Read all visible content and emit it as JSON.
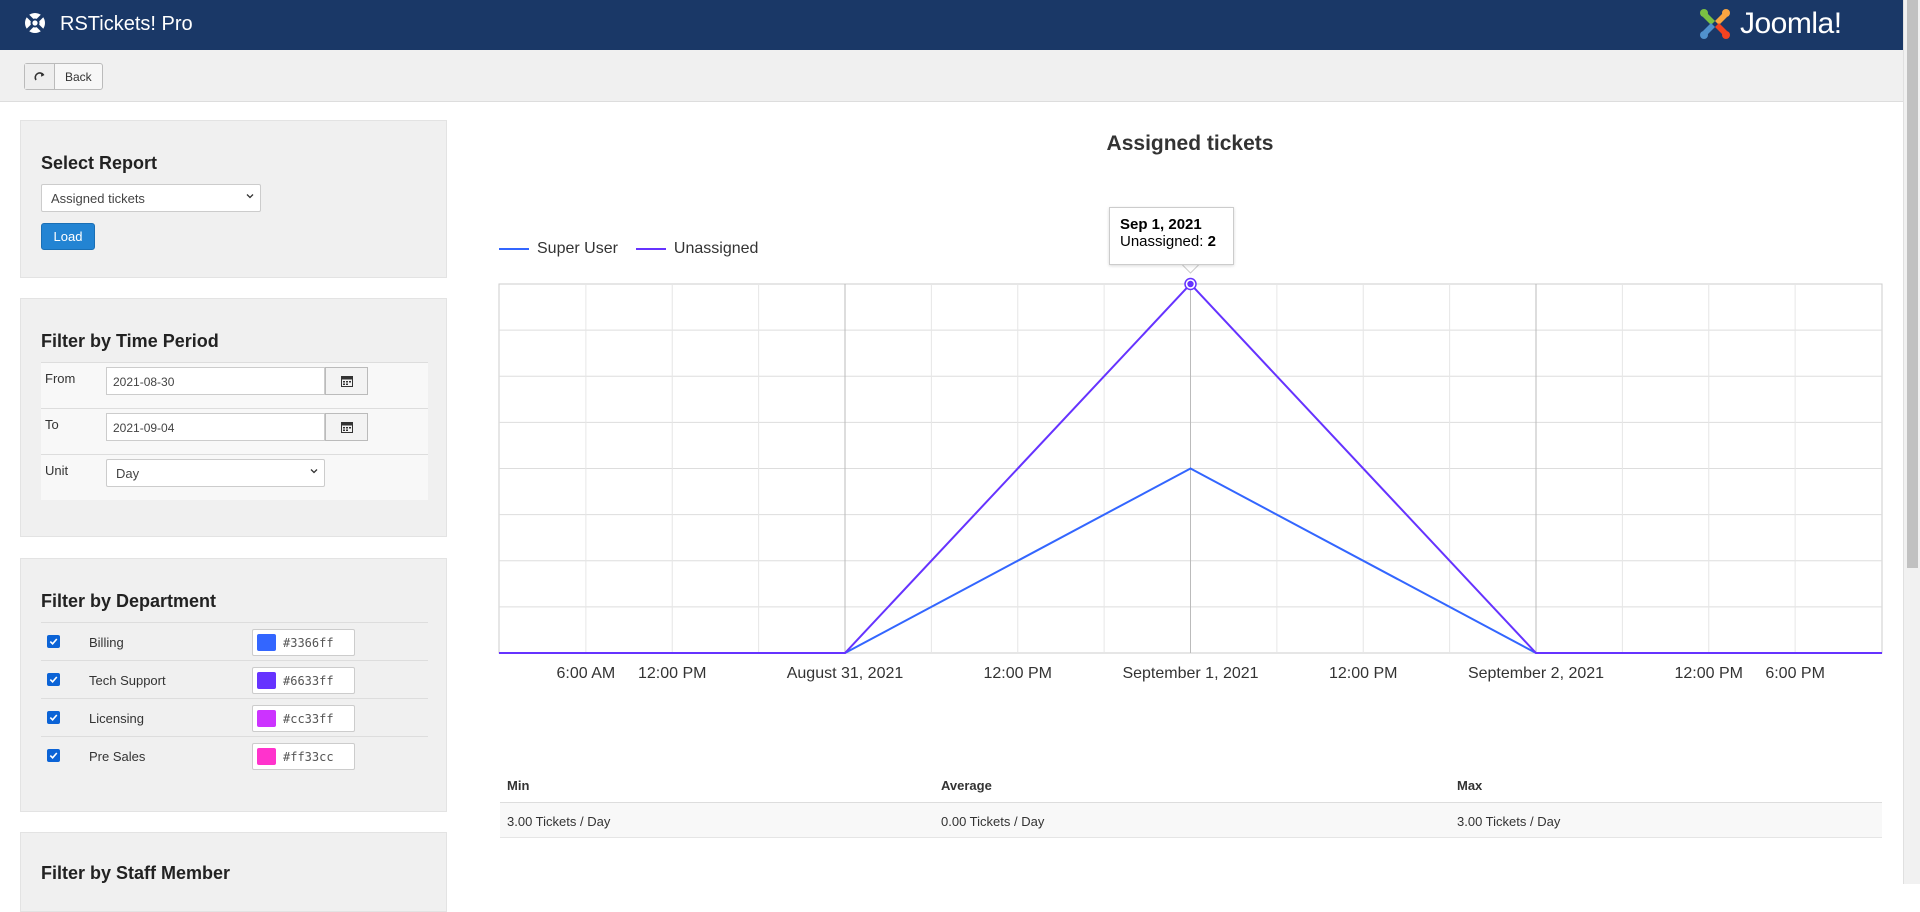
{
  "header": {
    "title": "RSTickets! Pro",
    "brand": "Joomla!",
    "color": "#1a3867"
  },
  "toolbar": {
    "back_label": "Back"
  },
  "select_report": {
    "heading": "Select Report",
    "selected": "Assigned tickets",
    "load_label": "Load"
  },
  "time_filter": {
    "heading": "Filter by Time Period",
    "from_label": "From",
    "from_value": "2021-08-30",
    "to_label": "To",
    "to_value": "2021-09-04",
    "unit_label": "Unit",
    "unit_value": "Day"
  },
  "department_filter": {
    "heading": "Filter by Department",
    "items": [
      {
        "name": "Billing",
        "color": "#3366ff",
        "checked": true
      },
      {
        "name": "Tech Support",
        "color": "#6633ff",
        "checked": true
      },
      {
        "name": "Licensing",
        "color": "#cc33ff",
        "checked": true
      },
      {
        "name": "Pre Sales",
        "color": "#ff33cc",
        "checked": true
      }
    ]
  },
  "staff_filter": {
    "heading": "Filter by Staff Member"
  },
  "tooltip": {
    "date": "Sep 1, 2021",
    "series": "Unassigned:",
    "value": "2"
  },
  "chart_data": {
    "type": "line",
    "title": "Assigned tickets",
    "x_tick_labels": [
      "6:00 AM",
      "12:00 PM",
      "August 31, 2021",
      "12:00 PM",
      "September 1, 2021",
      "12:00 PM",
      "September 2, 2021",
      "12:00 PM",
      "6:00 PM"
    ],
    "x": [
      "2021-08-31",
      "2021-09-01",
      "2021-09-02"
    ],
    "series": [
      {
        "name": "Super User",
        "color": "#3366ff",
        "values": [
          0,
          1,
          0
        ]
      },
      {
        "name": "Unassigned",
        "color": "#6633ff",
        "values": [
          0,
          2,
          0
        ]
      }
    ],
    "ylim": [
      0,
      2
    ],
    "grid": true,
    "legend": "top-left"
  },
  "stats": {
    "headers": [
      "Min",
      "Average",
      "Max"
    ],
    "values": [
      "3.00 Tickets / Day",
      "0.00 Tickets / Day",
      "3.00 Tickets / Day"
    ]
  }
}
